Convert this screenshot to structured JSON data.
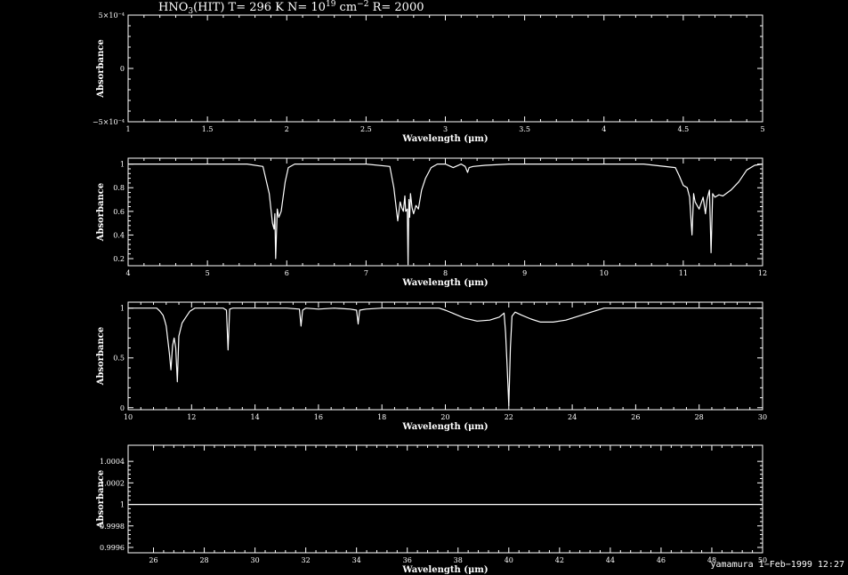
{
  "title": {
    "text": "HNO3(HIT) T= 296 K N= 10^19 cm^-2 R= 2000",
    "molecule": "HNO",
    "molecule_sub": "3",
    "rest": "(HIT) T= 296 K N= 10",
    "exp1": "19",
    "unit": " cm",
    "exp2": "−2",
    "tail": " R= 2000"
  },
  "footer": "yamamura  1−Feb−1999 12:27",
  "colors": {
    "background": "#000000",
    "foreground": "#ffffff"
  },
  "chart_data": [
    {
      "type": "line",
      "xlabel": "Wavelength (μm)",
      "ylabel": "Absorbance",
      "xlim": [
        1,
        5
      ],
      "ylim": [
        -0.0005,
        0.0005
      ],
      "xticks": [
        1,
        1.5,
        2,
        2.5,
        3,
        3.5,
        4,
        4.5,
        5
      ],
      "xtick_labels": [
        "1",
        "1.5",
        "2",
        "2.5",
        "3",
        "3.5",
        "4",
        "4.5",
        "5"
      ],
      "yticks": [
        -0.0005,
        0,
        0.0005
      ],
      "ytick_labels": [
        "−5×10⁻⁴",
        "0",
        "5×10⁻⁴"
      ],
      "series": [
        {
          "x": [],
          "y": []
        }
      ]
    },
    {
      "type": "line",
      "xlabel": "Wavelength (μm)",
      "ylabel": "Absorbance",
      "xlim": [
        4,
        12
      ],
      "ylim": [
        0.14,
        1.05
      ],
      "xticks": [
        4,
        5,
        6,
        7,
        8,
        9,
        10,
        11,
        12
      ],
      "xtick_labels": [
        "4",
        "5",
        "6",
        "7",
        "8",
        "9",
        "10",
        "11",
        "12"
      ],
      "yticks": [
        0.2,
        0.4,
        0.6,
        0.8,
        1
      ],
      "ytick_labels": [
        "0.2",
        "0.4",
        "0.6",
        "0.8",
        "1"
      ],
      "series": [
        {
          "x": [
            4.0,
            5.5,
            5.7,
            5.78,
            5.82,
            5.84,
            5.85,
            5.86,
            5.88,
            5.9,
            5.93,
            5.98,
            6.02,
            6.1,
            6.3,
            7.0,
            7.3,
            7.35,
            7.4,
            7.43,
            7.45,
            7.47,
            7.49,
            7.5,
            7.52,
            7.53,
            7.54,
            7.55,
            7.56,
            7.58,
            7.6,
            7.63,
            7.66,
            7.7,
            7.75,
            7.82,
            7.9,
            8.0,
            8.1,
            8.2,
            8.25,
            8.28,
            8.3,
            8.35,
            8.5,
            8.8,
            9.5,
            10.5,
            10.9,
            10.95,
            11.0,
            11.05,
            11.08,
            11.1,
            11.11,
            11.13,
            11.15,
            11.2,
            11.25,
            11.28,
            11.3,
            11.33,
            11.35,
            11.37,
            11.4,
            11.45,
            11.5,
            11.6,
            11.7,
            11.8,
            11.9,
            12.0
          ],
          "y": [
            1.0,
            1.0,
            0.98,
            0.75,
            0.5,
            0.45,
            0.58,
            0.2,
            0.62,
            0.55,
            0.6,
            0.85,
            0.97,
            1.0,
            1.0,
            1.0,
            0.98,
            0.8,
            0.52,
            0.68,
            0.63,
            0.6,
            0.73,
            0.6,
            0.62,
            0.15,
            0.7,
            0.55,
            0.75,
            0.63,
            0.58,
            0.65,
            0.62,
            0.78,
            0.88,
            0.97,
            1.0,
            1.0,
            0.97,
            1.0,
            0.98,
            0.93,
            0.97,
            0.98,
            0.99,
            1.0,
            1.0,
            1.0,
            0.97,
            0.9,
            0.82,
            0.8,
            0.72,
            0.5,
            0.4,
            0.75,
            0.68,
            0.62,
            0.72,
            0.58,
            0.7,
            0.78,
            0.25,
            0.75,
            0.72,
            0.74,
            0.73,
            0.78,
            0.85,
            0.95,
            0.99,
            1.0
          ]
        }
      ]
    },
    {
      "type": "line",
      "xlabel": "Wavelength (μm)",
      "ylabel": "Absorbance",
      "xlim": [
        10,
        30
      ],
      "ylim": [
        -0.02,
        1.06
      ],
      "xticks": [
        10,
        12,
        14,
        16,
        18,
        20,
        22,
        24,
        26,
        28,
        30
      ],
      "xtick_labels": [
        "10",
        "12",
        "14",
        "16",
        "18",
        "20",
        "22",
        "24",
        "26",
        "28",
        "30"
      ],
      "yticks": [
        0,
        0.5,
        1
      ],
      "ytick_labels": [
        "0",
        "0.5",
        "1"
      ],
      "series": [
        {
          "x": [
            10.0,
            10.9,
            11.0,
            11.1,
            11.15,
            11.2,
            11.25,
            11.3,
            11.35,
            11.4,
            11.45,
            11.5,
            11.55,
            11.6,
            11.7,
            11.8,
            11.95,
            12.1,
            12.3,
            13.0,
            13.1,
            13.15,
            13.2,
            13.3,
            14.0,
            15.0,
            15.4,
            15.45,
            15.5,
            15.6,
            16.0,
            16.5,
            17.0,
            17.2,
            17.25,
            17.3,
            17.5,
            18.0,
            19.0,
            19.8,
            20.0,
            20.3,
            20.6,
            21.0,
            21.4,
            21.7,
            21.85,
            21.9,
            21.95,
            22.0,
            22.05,
            22.1,
            22.2,
            22.4,
            22.7,
            23.0,
            23.4,
            23.8,
            24.2,
            24.6,
            25.0,
            30.0
          ],
          "y": [
            1.0,
            1.0,
            0.97,
            0.93,
            0.88,
            0.82,
            0.68,
            0.55,
            0.38,
            0.62,
            0.7,
            0.6,
            0.26,
            0.72,
            0.85,
            0.9,
            0.97,
            1.0,
            1.0,
            1.0,
            0.98,
            0.58,
            0.99,
            1.0,
            1.0,
            1.0,
            0.99,
            0.82,
            0.98,
            1.0,
            0.99,
            1.0,
            0.99,
            0.98,
            0.84,
            0.98,
            0.99,
            1.0,
            1.0,
            1.0,
            0.98,
            0.94,
            0.9,
            0.87,
            0.88,
            0.91,
            0.95,
            0.75,
            0.4,
            0.02,
            0.6,
            0.92,
            0.96,
            0.93,
            0.89,
            0.86,
            0.86,
            0.88,
            0.92,
            0.96,
            1.0,
            1.0
          ]
        }
      ]
    },
    {
      "type": "line",
      "xlabel": "Wavelength (μm)",
      "ylabel": "Absorbance",
      "xlim": [
        25,
        50
      ],
      "ylim": [
        0.99955,
        1.00055
      ],
      "xticks": [
        26,
        28,
        30,
        32,
        34,
        36,
        38,
        40,
        42,
        44,
        46,
        48,
        50
      ],
      "xtick_labels": [
        "26",
        "28",
        "30",
        "32",
        "34",
        "36",
        "38",
        "40",
        "42",
        "44",
        "46",
        "48",
        "50"
      ],
      "yticks": [
        0.9996,
        0.9998,
        1,
        1.0002,
        1.0004
      ],
      "ytick_labels": [
        "0.9996",
        "0.9998",
        "1",
        "1.0002",
        "1.0004"
      ],
      "series": [
        {
          "x": [
            25,
            50
          ],
          "y": [
            1,
            1
          ]
        }
      ]
    }
  ]
}
